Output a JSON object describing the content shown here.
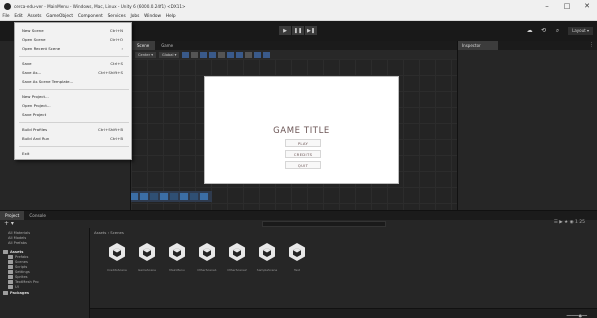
{
  "window": {
    "title": "cerca-edu-ver - MainMenu - Windows, Mac, Linux - Unity 6 (6000.0.24f1) <DX11>",
    "controls": {
      "minimize": "–",
      "maximize": "□",
      "close": "✕"
    }
  },
  "menubar": {
    "items": [
      "File",
      "Edit",
      "Assets",
      "GameObject",
      "Component",
      "Services",
      "Jobs",
      "Window",
      "Help"
    ]
  },
  "file_menu": {
    "items": [
      {
        "label": "New Scene",
        "shortcut": "Ctrl+N"
      },
      {
        "label": "Open Scene",
        "shortcut": "Ctrl+O"
      },
      {
        "label": "Open Recent Scene",
        "shortcut": "›"
      },
      {
        "label": "Save",
        "shortcut": "Ctrl+S"
      },
      {
        "label": "Save As...",
        "shortcut": "Ctrl+Shift+S"
      },
      {
        "label": "Save As Scene Template...",
        "shortcut": ""
      },
      {
        "label": "New Project...",
        "shortcut": ""
      },
      {
        "label": "Open Project...",
        "shortcut": ""
      },
      {
        "label": "Save Project",
        "shortcut": ""
      },
      {
        "label": "Build Profiles",
        "shortcut": "Ctrl+Shift+B"
      },
      {
        "label": "Build And Run",
        "shortcut": "Ctrl+B"
      },
      {
        "label": "Exit",
        "shortcut": ""
      }
    ]
  },
  "toolbar": {
    "play": "▶",
    "pause": "❚❚",
    "step": "▶❚",
    "layout_label": "Layout ▾"
  },
  "scene_panel": {
    "tabs": [
      "Scene",
      "Game"
    ],
    "shading_dropdown": "Center ▾",
    "pivot_dropdown": "Global ▾"
  },
  "game_preview": {
    "title": "GAME TITLE",
    "buttons": [
      "PLAY",
      "CREDITS",
      "QUIT"
    ]
  },
  "inspector": {
    "tab_label": "Inspector",
    "menu": "⋮"
  },
  "project": {
    "tabs": [
      "Project",
      "Console"
    ],
    "add": "+ ▾",
    "toolbar_icons": "☰ ▶ ★ ◉ 𝟙 25",
    "favorites": [
      "All Materials",
      "All Models",
      "All Prefabs"
    ],
    "tree": [
      "Assets",
      "Prefabs",
      "Scenes",
      "Scripts",
      "Settings",
      "Sprites",
      "TextMesh Pro",
      "UI",
      "Packages"
    ],
    "breadcrumb": "Assets › Scenes",
    "assets": [
      "CreditsScene",
      "GameScene",
      "MainMenu",
      "OtherScene1",
      "OtherScene2",
      "SampleScene",
      "Test"
    ]
  },
  "colors": {
    "accent": "#3b6ea6",
    "game_title": "#6b5555"
  }
}
